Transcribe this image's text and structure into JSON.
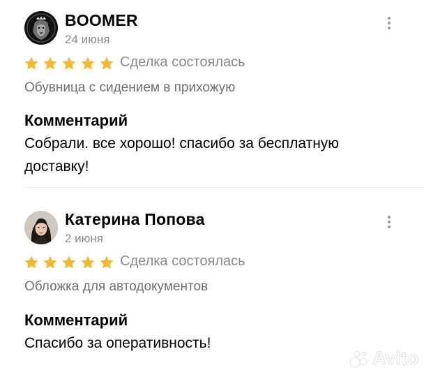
{
  "reviews": [
    {
      "author": "BOOMER",
      "date": "24 июня",
      "rating": 5,
      "deal_status": "Сделка состоялась",
      "product": "Обувница с сидением в прихожую",
      "comment_title": "Комментарий",
      "comment": "Собрали. все хорошо! спасибо за бесплатную доставку!",
      "avatar": "lion-logo-icon"
    },
    {
      "author": "Катерина Попова",
      "date": "2 июня",
      "rating": 5,
      "deal_status": "Сделка состоялась",
      "product": "Обложка для автодокументов",
      "comment_title": "Комментарий",
      "comment": "Спасибо за оперативность!",
      "avatar": "user-photo"
    }
  ],
  "colors": {
    "star": "#f5b82e",
    "secondary_text": "#8a8a8a",
    "divider": "#e6e6e6"
  },
  "watermark": {
    "text": "Avito",
    "icon": "avito-logo-icon"
  }
}
